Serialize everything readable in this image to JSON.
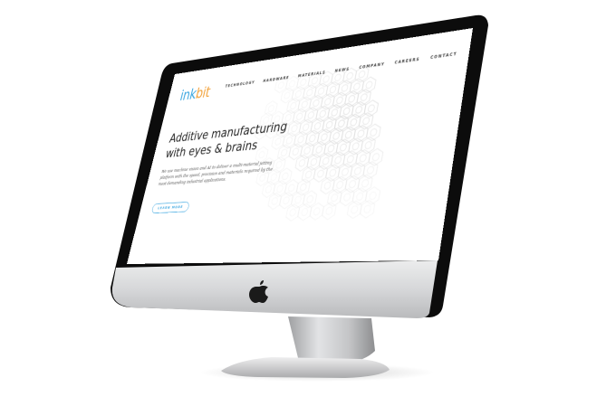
{
  "site": {
    "logo": {
      "prefix": "ink",
      "suffix": "bit"
    },
    "nav": [
      "TECHNOLOGY",
      "HARDWARE",
      "MATERIALS",
      "NEWS",
      "COMPANY",
      "CAREERS",
      "CONTACT"
    ],
    "hero": {
      "title_line1": "Additive manufacturing",
      "title_line2": "with eyes & brains",
      "body": "We use machine vision and AI to deliver a multi-material jetting platform with the speed, precision and materials required by the most demanding industrial applications.",
      "cta_label": "LEARN MORE"
    }
  },
  "device": {
    "brand_icon": "apple-logo-icon"
  },
  "colors": {
    "brand_blue": "#3aa6e0",
    "brand_orange": "#f2a23a",
    "bezel": "#0d0d0d",
    "chin": "#d9dadc",
    "stand": "#c9cacc"
  }
}
